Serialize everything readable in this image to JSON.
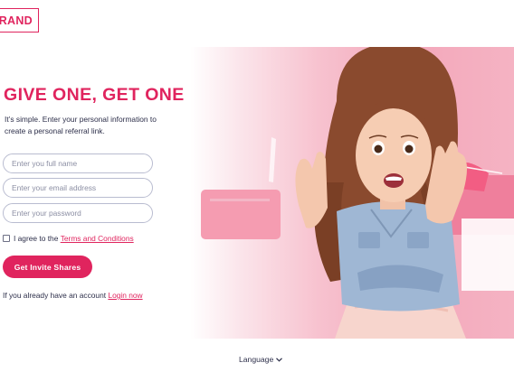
{
  "brand": {
    "logo_text": "RAND"
  },
  "hero": {
    "headline": "GIVE ONE, GET ONE",
    "intro": "It’s simple. Enter your personal information to create a personal referral link.",
    "image_subject": "smiling girl with gift bags"
  },
  "form": {
    "name_placeholder": "Enter you full name",
    "email_placeholder": "Enter your email address",
    "password_placeholder": "Enter your password",
    "agree_text": "I agree to the ",
    "terms_link": "Terms and Conditions",
    "submit_label": "Get Invite Shares",
    "account_text": "If you already have an account ",
    "login_link": "Login now"
  },
  "footer": {
    "language_label": "Language"
  },
  "colors": {
    "accent": "#e0245e",
    "text": "#2d2f4a",
    "field_border": "#b9bcd0"
  }
}
